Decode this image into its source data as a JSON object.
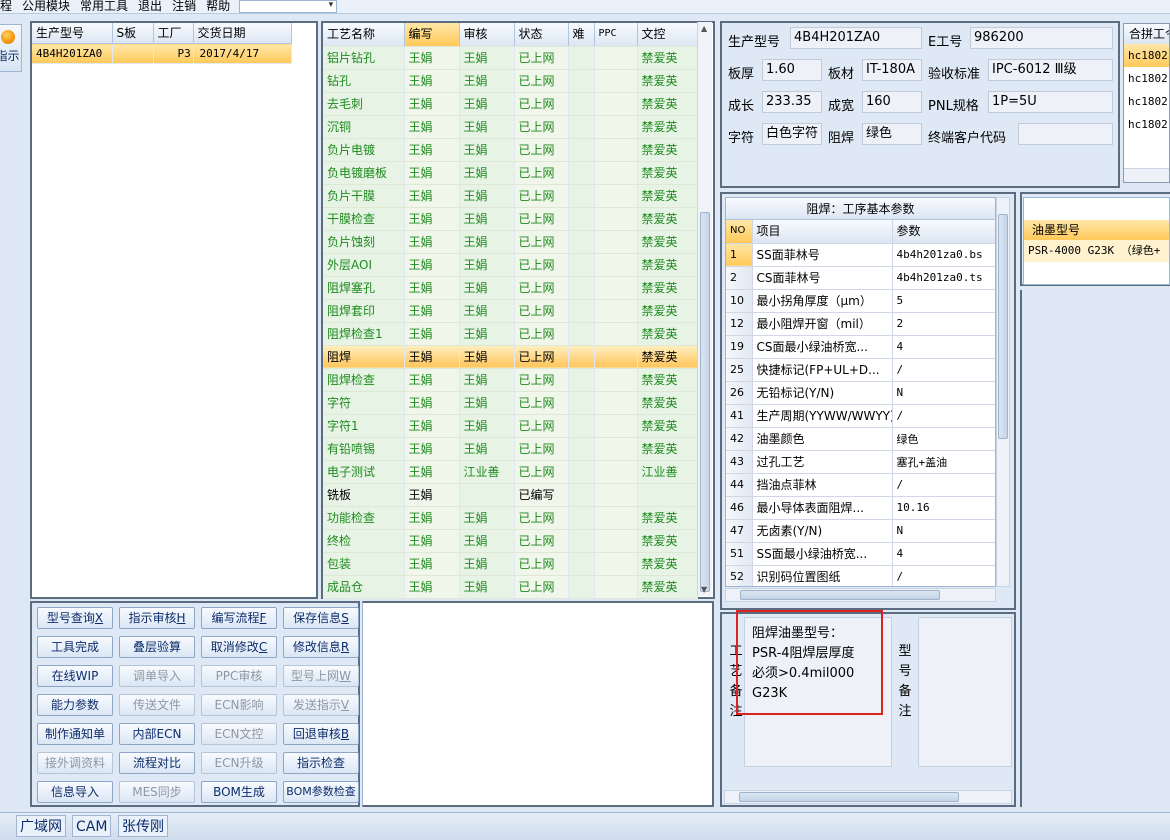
{
  "menu": {
    "items": [
      "程",
      "公用模块",
      "常用工具",
      "退出",
      "注销",
      "帮助"
    ],
    "combo_arrow": "▾"
  },
  "left_button": {
    "label": "指示",
    "icon": "orange-circle-icon"
  },
  "orders": {
    "headers": [
      "生产型号",
      "S板",
      "工厂",
      "交货日期"
    ],
    "rows": [
      [
        "4B4H201ZA0",
        "",
        "P3",
        "2017/4/17"
      ]
    ]
  },
  "process": {
    "headers": [
      "工艺名称",
      "编写",
      "审核",
      "状态",
      "难",
      "PPC",
      "文控"
    ],
    "current_index": 13,
    "rows": [
      [
        "铝片钻孔",
        "王娟",
        "王娟",
        "已上网",
        "",
        "",
        "禁爱英"
      ],
      [
        "钻孔",
        "王娟",
        "王娟",
        "已上网",
        "",
        "",
        "禁爱英"
      ],
      [
        "去毛刺",
        "王娟",
        "王娟",
        "已上网",
        "",
        "",
        "禁爱英"
      ],
      [
        "沉铜",
        "王娟",
        "王娟",
        "已上网",
        "",
        "",
        "禁爱英"
      ],
      [
        "负片电镀",
        "王娟",
        "王娟",
        "已上网",
        "",
        "",
        "禁爱英"
      ],
      [
        "负电镀磨板",
        "王娟",
        "王娟",
        "已上网",
        "",
        "",
        "禁爱英"
      ],
      [
        "负片干膜",
        "王娟",
        "王娟",
        "已上网",
        "",
        "",
        "禁爱英"
      ],
      [
        "干膜检查",
        "王娟",
        "王娟",
        "已上网",
        "",
        "",
        "禁爱英"
      ],
      [
        "负片蚀刻",
        "王娟",
        "王娟",
        "已上网",
        "",
        "",
        "禁爱英"
      ],
      [
        "外层AOI",
        "王娟",
        "王娟",
        "已上网",
        "",
        "",
        "禁爱英"
      ],
      [
        "阻焊塞孔",
        "王娟",
        "王娟",
        "已上网",
        "",
        "",
        "禁爱英"
      ],
      [
        "阻焊套印",
        "王娟",
        "王娟",
        "已上网",
        "",
        "",
        "禁爱英"
      ],
      [
        "阻焊检查1",
        "王娟",
        "王娟",
        "已上网",
        "",
        "",
        "禁爱英"
      ],
      [
        "阻焊",
        "王娟",
        "王娟",
        "已上网",
        "",
        "",
        "禁爱英"
      ],
      [
        "阻焊检查",
        "王娟",
        "王娟",
        "已上网",
        "",
        "",
        "禁爱英"
      ],
      [
        "字符",
        "王娟",
        "王娟",
        "已上网",
        "",
        "",
        "禁爱英"
      ],
      [
        "字符1",
        "王娟",
        "王娟",
        "已上网",
        "",
        "",
        "禁爱英"
      ],
      [
        "有铅喷锡",
        "王娟",
        "王娟",
        "已上网",
        "",
        "",
        "禁爱英"
      ],
      [
        "电子测试",
        "王娟",
        "江业善",
        "已上网",
        "",
        "",
        "江业善"
      ],
      [
        "铣板",
        "王娟",
        "",
        "已编写",
        "",
        "",
        ""
      ],
      [
        "功能检查",
        "王娟",
        "王娟",
        "已上网",
        "",
        "",
        "禁爱英"
      ],
      [
        "终检",
        "王娟",
        "王娟",
        "已上网",
        "",
        "",
        "禁爱英"
      ],
      [
        "包装",
        "王娟",
        "王娟",
        "已上网",
        "",
        "",
        "禁爱英"
      ],
      [
        "成品仓",
        "王娟",
        "王娟",
        "已上网",
        "",
        "",
        "禁爱英"
      ]
    ]
  },
  "info": {
    "model_label": "生产型号",
    "model": "4B4H201ZA0",
    "eno_label": "E工号",
    "eno": "986200",
    "thick_label": "板厚",
    "thick": "1.60",
    "material_label": "板材",
    "material": "IT-180A",
    "std_label": "验收标准",
    "std": "IPC-6012 Ⅲ级",
    "len_label": "成长",
    "len": "233.35",
    "wid_label": "成宽",
    "wid": "160",
    "pnl_label": "PNL规格",
    "pnl": "1P=5U",
    "char_label": "字符",
    "char": "白色字符",
    "mask_label": "阻焊",
    "mask": "绿色",
    "cust_label": "终端客户代码",
    "cust": ""
  },
  "merge": {
    "header": "合拼工令",
    "rows": [
      "hc1802",
      "hc1802",
      "hc1802",
      "hc1802"
    ]
  },
  "params": {
    "title": "阻焊：工序基本参数",
    "headers": [
      "NO",
      "项目",
      "参数"
    ],
    "rows": [
      [
        "1",
        "SS面菲林号",
        "4b4h201za0.bs"
      ],
      [
        "2",
        "CS面菲林号",
        "4b4h201za0.ts"
      ],
      [
        "10",
        "最小拐角厚度（μm）",
        "5"
      ],
      [
        "12",
        "最小阻焊开窗（mil）",
        "2"
      ],
      [
        "19",
        "CS面最小绿油桥宽...",
        "4"
      ],
      [
        "25",
        "快捷标记(FP+UL+D...",
        "/"
      ],
      [
        "26",
        "无铅标记(Y/N)",
        "N"
      ],
      [
        "41",
        "生产周期(YYWW/WWYY)",
        "/"
      ],
      [
        "42",
        "油墨颜色",
        "绿色"
      ],
      [
        "43",
        "过孔工艺",
        "塞孔+盖油"
      ],
      [
        "44",
        "挡油点菲林",
        "/"
      ],
      [
        "46",
        "最小导体表面阻焊...",
        "10.16"
      ],
      [
        "47",
        "无卤素(Y/N)",
        "N"
      ],
      [
        "51",
        "SS面最小绿油桥宽...",
        "4"
      ],
      [
        "52",
        "识别码位置图纸",
        "/"
      ]
    ]
  },
  "ink": {
    "header": "油墨型号",
    "row": "PSR-4000 G23K （绿色+"
  },
  "buttons": [
    [
      "型号查询",
      "X",
      false
    ],
    [
      "指示审核",
      "H",
      false
    ],
    [
      "编写流程",
      "F",
      false
    ],
    [
      "保存信息",
      "S",
      false
    ],
    [
      "工具完成",
      "",
      false
    ],
    [
      "叠层验算",
      "",
      false
    ],
    [
      "取消修改",
      "C",
      false
    ],
    [
      "修改信息",
      "R",
      false
    ],
    [
      "在线WIP",
      "",
      false
    ],
    [
      "调单导入",
      "",
      true
    ],
    [
      "PPC审核",
      "",
      true
    ],
    [
      "型号上网",
      "W",
      true
    ],
    [
      "能力参数",
      "",
      false
    ],
    [
      "传送文件",
      "",
      true
    ],
    [
      "ECN影响",
      "",
      true
    ],
    [
      "发送指示",
      "V",
      true
    ],
    [
      "制作通知单",
      "",
      false
    ],
    [
      "内部ECN",
      "",
      false
    ],
    [
      "ECN文控",
      "",
      true
    ],
    [
      "回退审核",
      "B",
      false
    ],
    [
      "接外调资料",
      "",
      true
    ],
    [
      "流程对比",
      "",
      false
    ],
    [
      "ECN升级",
      "",
      true
    ],
    [
      "指示检查",
      "",
      false
    ],
    [
      "信息导入",
      "",
      false
    ],
    [
      "MES同步",
      "",
      true
    ],
    [
      "BOM生成",
      "",
      false
    ],
    [
      "BOM参数检查",
      "",
      false
    ]
  ],
  "remarks": {
    "label1": [
      "工",
      "艺",
      "备",
      "注"
    ],
    "text": "阻焊油墨型号：\nPSR-4阻焊层厚度\n必须>0.4mil000\nG23K",
    "label2": [
      "型",
      "号",
      "备",
      "注"
    ]
  },
  "status": {
    "items": [
      "广域网",
      "CAM",
      "张传刚"
    ]
  }
}
